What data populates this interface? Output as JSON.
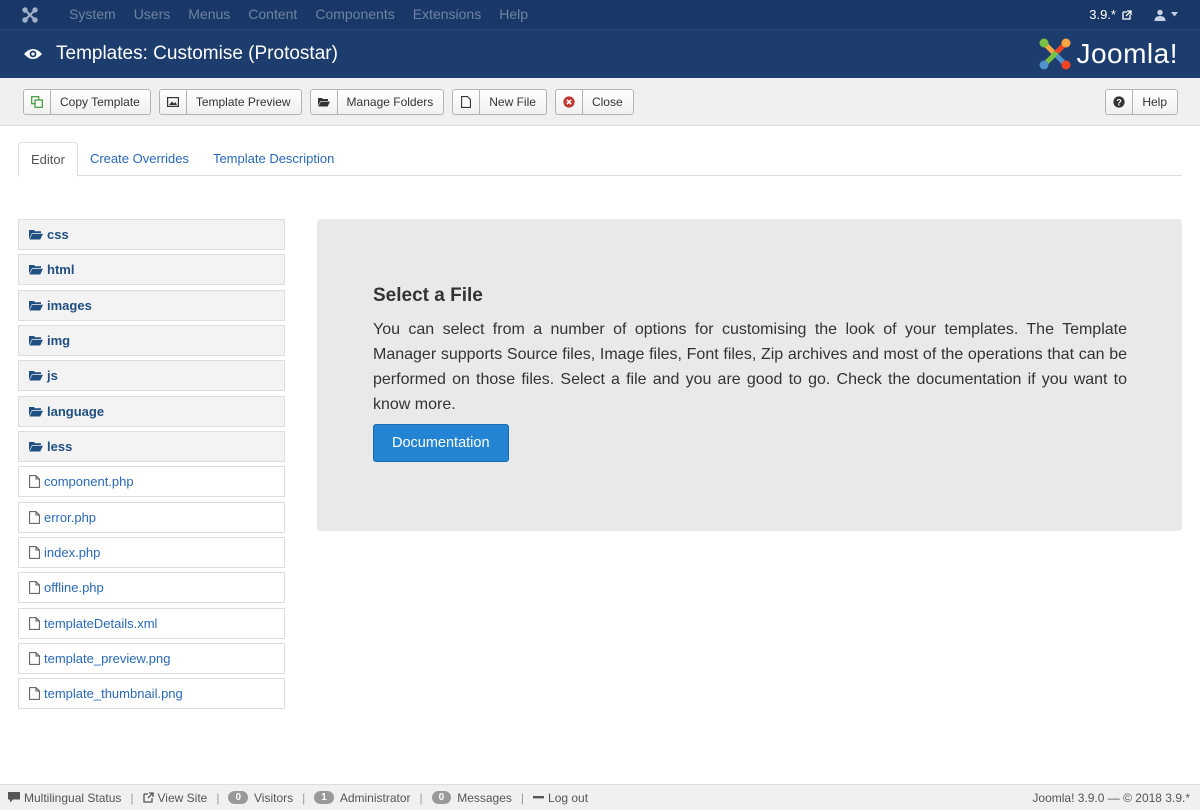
{
  "topbar": {
    "menu": [
      "System",
      "Users",
      "Menus",
      "Content",
      "Components",
      "Extensions",
      "Help"
    ],
    "version": "3.9.*"
  },
  "header": {
    "title": "Templates: Customise (Protostar)",
    "brand": "Joomla!"
  },
  "toolbar": {
    "copy_template": "Copy Template",
    "template_preview": "Template Preview",
    "manage_folders": "Manage Folders",
    "new_file": "New File",
    "close": "Close",
    "help": "Help"
  },
  "tabs": [
    "Editor",
    "Create Overrides",
    "Template Description"
  ],
  "tree": {
    "folders": [
      "css",
      "html",
      "images",
      "img",
      "js",
      "language",
      "less"
    ],
    "files": [
      "component.php",
      "error.php",
      "index.php",
      "offline.php",
      "templateDetails.xml",
      "template_preview.png",
      "template_thumbnail.png"
    ]
  },
  "panel": {
    "heading": "Select a File",
    "body": "You can select from a number of options for customising the look of your templates. The Template Manager supports Source files, Image files, Font files, Zip archives and most of the operations that can be performed on those files. Select a file and you are good to go. Check the documentation if you want to know more.",
    "button": "Documentation"
  },
  "status": {
    "multilingual": "Multilingual Status",
    "view_site": "View Site",
    "visitors_count": "0",
    "visitors": "Visitors",
    "admin_count": "1",
    "administrator": "Administrator",
    "messages_count": "0",
    "messages": "Messages",
    "logout": "Log out",
    "footer": "Joomla! 3.9.0 — © 2018 3.9.*"
  },
  "colors": {
    "topbar": "#1a3867",
    "header": "#1c3d6e",
    "link": "#2a69b8",
    "primary_button": "#2384d3"
  }
}
